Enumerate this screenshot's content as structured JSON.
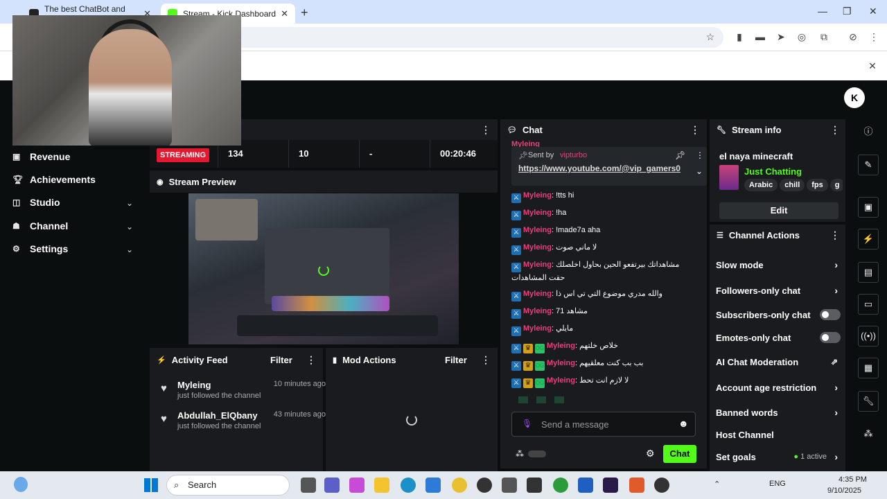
{
  "browser": {
    "tab1_title": "The best ChatBot and Widgets",
    "tab2_title": "Stream - Kick Dashboard",
    "new_tab": "+",
    "close": "✕"
  },
  "sidebar": {
    "items": [
      {
        "label": "Revenue",
        "icon": "revenue-icon"
      },
      {
        "label": "Achievements",
        "icon": "trophy-icon"
      },
      {
        "label": "Studio",
        "icon": "studio-icon"
      },
      {
        "label": "Channel",
        "icon": "channel-icon"
      },
      {
        "label": "Settings",
        "icon": "gear-icon"
      }
    ]
  },
  "stats": {
    "badge": "STREAMING",
    "viewers": "134",
    "followers": "10",
    "other": "-",
    "uptime": "00:20:46"
  },
  "preview": {
    "title": "Stream Preview"
  },
  "activity": {
    "title": "Activity Feed",
    "filter": "Filter",
    "items": [
      {
        "name": "Myleing",
        "time": "10 minutes ago",
        "desc": "just followed the channel"
      },
      {
        "name": "Abdullah_ElQbany",
        "time": "43 minutes ago",
        "desc": "just followed the channel"
      }
    ]
  },
  "mod": {
    "title": "Mod Actions",
    "filter": "Filter"
  },
  "chat": {
    "title": "Chat",
    "pinned_top": "Myleing",
    "pinned_sent_by": "Sent by",
    "pinned_user": "vipturbo",
    "pinned_link": "https://www.youtube.com/@vip_gamers0",
    "messages": [
      {
        "user": "Myleing",
        "text": "!tts hi",
        "badges": [
          "mod"
        ]
      },
      {
        "user": "Myleing",
        "text": "!ha",
        "badges": [
          "mod"
        ]
      },
      {
        "user": "Myleing",
        "text": "!made7a aha",
        "badges": [
          "mod"
        ]
      },
      {
        "user": "Myleing",
        "text": "لا ماني صوت",
        "badges": [
          "mod"
        ]
      },
      {
        "user": "Myleing",
        "text": "مشاهداتك بيرتفعو الحين بحاول اخلصلك حقت المشاهدات",
        "badges": [
          "mod"
        ]
      },
      {
        "user": "Myleing",
        "text": "والله مدري موضوع التي تي اس ذا",
        "badges": [
          "mod"
        ]
      },
      {
        "user": "Myleing",
        "text": "71 مشاهد",
        "badges": [
          "mod"
        ]
      },
      {
        "user": "Myleing",
        "text": "مايلي",
        "badges": [
          "mod"
        ]
      },
      {
        "user": "Myleing",
        "text": "خلاص خلتهم",
        "badges": [
          "mod",
          "crown",
          "og"
        ]
      },
      {
        "user": "Myleing",
        "text": "بب بب كنت معلقيهم",
        "badges": [
          "mod",
          "crown",
          "og"
        ]
      },
      {
        "user": "Myleing",
        "text": "لا لازم انت تحط",
        "badges": [
          "mod",
          "crown",
          "og"
        ]
      }
    ],
    "input_placeholder": "Send a message",
    "send_label": "Chat"
  },
  "stream_info": {
    "title": "Stream info",
    "stream_title": "el naya minecraft",
    "category": "Just Chatting",
    "tags": [
      "Arabic",
      "chill",
      "fps",
      "g"
    ],
    "edit_label": "Edit"
  },
  "channel_actions": {
    "title": "Channel Actions",
    "items": [
      {
        "label": "Slow mode",
        "kind": "arrow"
      },
      {
        "label": "Followers-only chat",
        "kind": "arrow"
      },
      {
        "label": "Subscribers-only chat",
        "kind": "toggle"
      },
      {
        "label": "Emotes-only chat",
        "kind": "toggle"
      },
      {
        "label": "AI Chat Moderation",
        "kind": "external"
      },
      {
        "label": "Account age restriction",
        "kind": "arrow"
      },
      {
        "label": "Banned words",
        "kind": "arrow"
      },
      {
        "label": "Host Channel",
        "kind": "none"
      },
      {
        "label": "Set goals",
        "kind": "arrow"
      }
    ],
    "goals_status": "1 active"
  },
  "taskbar": {
    "search_label": "Search",
    "lang": "ENG",
    "time": "4:35 PM",
    "date": "9/10/2025"
  },
  "colors": {
    "accent": "#53fc18",
    "streaming": "#e4192f",
    "username": "#e9407a"
  }
}
